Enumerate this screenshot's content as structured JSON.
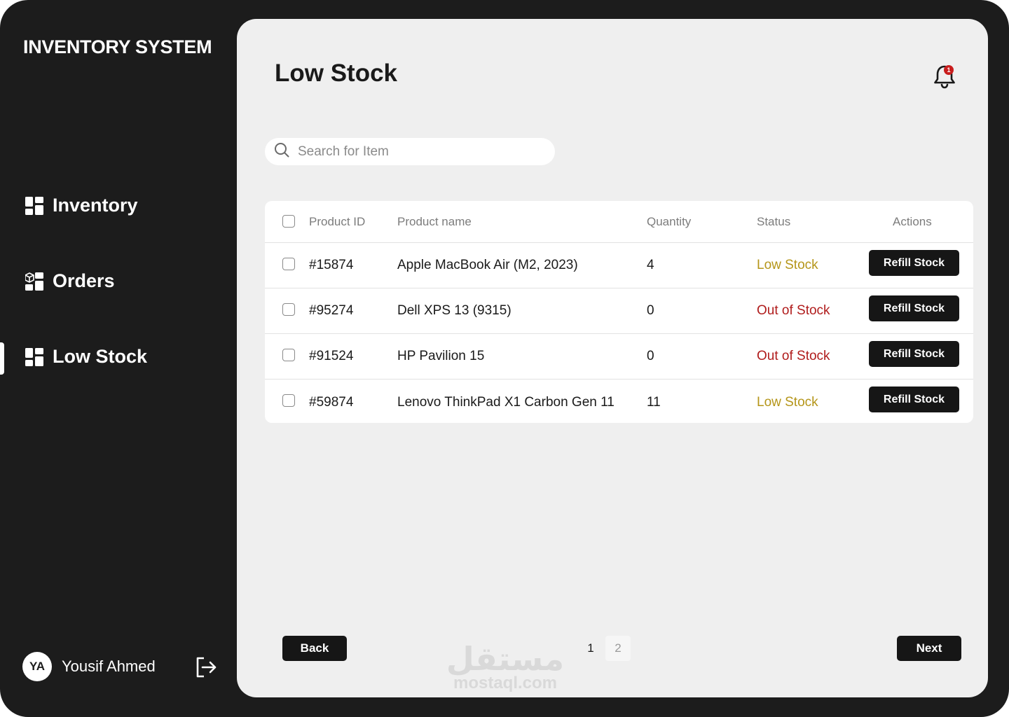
{
  "sidebar": {
    "brand": "INVENTORY SYSTEM",
    "items": [
      {
        "label": "Inventory",
        "icon": "dashboard-grid-icon",
        "active": false
      },
      {
        "label": "Orders",
        "icon": "orders-box-icon",
        "active": false
      },
      {
        "label": "Low Stock",
        "icon": "dashboard-grid-icon",
        "active": true
      }
    ],
    "user": {
      "initials": "YA",
      "name": "Yousif Ahmed"
    },
    "logout_icon": "logout-icon"
  },
  "header": {
    "title": "Low Stock",
    "notification_icon": "bell-icon",
    "notification_count": "1"
  },
  "search": {
    "placeholder": "Search for Item",
    "value": ""
  },
  "table": {
    "columns": [
      "Product ID",
      "Product name",
      "Quantity",
      "Status",
      "Actions"
    ],
    "rows": [
      {
        "id": "#15874",
        "name": "Apple MacBook Air (M2, 2023)",
        "quantity": "4",
        "status": "Low Stock",
        "action": "Refill Stock"
      },
      {
        "id": "#95274",
        "name": "Dell XPS 13 (9315)",
        "quantity": "0",
        "status": "Out of Stock",
        "action": "Refill Stock"
      },
      {
        "id": "#91524",
        "name": "HP Pavilion 15",
        "quantity": "0",
        "status": "Out of Stock",
        "action": "Refill Stock"
      },
      {
        "id": "#59874",
        "name": "Lenovo ThinkPad X1 Carbon Gen 11",
        "quantity": "11",
        "status": "Low Stock",
        "action": "Refill Stock"
      }
    ]
  },
  "pagination": {
    "back_label": "Back",
    "next_label": "Next",
    "pages": [
      "1",
      "2"
    ],
    "current": "1"
  },
  "watermark": {
    "arabic": "مستقل",
    "latin": "mostaql.com"
  },
  "colors": {
    "sidebar_bg": "#1c1c1c",
    "main_bg": "#efefef",
    "low_stock": "#b5961a",
    "out_of_stock": "#b01c1c",
    "button_bg": "#161616"
  }
}
